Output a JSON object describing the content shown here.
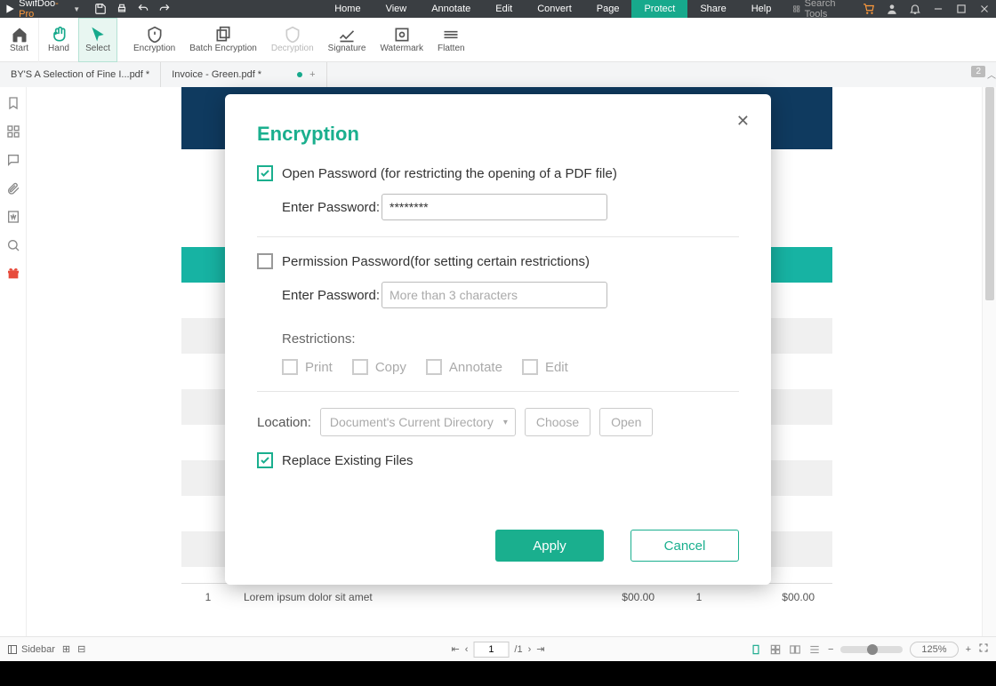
{
  "app": {
    "name1": "SwifDoo",
    "name2": "-Pro"
  },
  "menus": [
    "Home",
    "View",
    "Annotate",
    "Edit",
    "Convert",
    "Page",
    "Protect",
    "Share",
    "Help"
  ],
  "menus_active": 6,
  "search_placeholder": "Search Tools",
  "ribbon": [
    {
      "label": "Start"
    },
    {
      "label": "Hand"
    },
    {
      "label": "Select"
    },
    {
      "label": "Encryption"
    },
    {
      "label": "Batch Encryption"
    },
    {
      "label": "Decryption"
    },
    {
      "label": "Signature"
    },
    {
      "label": "Watermark"
    },
    {
      "label": "Flatten"
    }
  ],
  "tabs": [
    {
      "label": "BY'S A Selection of Fine I...pdf *"
    },
    {
      "label": "Invoice - Green.pdf *"
    }
  ],
  "tab_counter": "2",
  "table_row": {
    "num": "1",
    "desc": "Lorem ipsum dolor sit amet",
    "unit": "$00.00",
    "qty": "1",
    "line": "$00.00"
  },
  "status": {
    "sidebar": "Sidebar",
    "page_current": "1",
    "page_total": "/1",
    "zoom": "125%"
  },
  "modal": {
    "title": "Encryption",
    "open_pw_label": "Open Password (for restricting the opening of a PDF file)",
    "enter_pw": "Enter Password:",
    "open_pw_value": "********",
    "perm_pw_label": "Permission Password(for setting certain restrictions)",
    "perm_pw_placeholder": "More than 3 characters",
    "restrictions_label": "Restrictions:",
    "restrictions": [
      "Print",
      "Copy",
      "Annotate",
      "Edit"
    ],
    "location_label": "Location:",
    "location_value": "Document's Current Directory",
    "choose": "Choose",
    "open": "Open",
    "replace_label": "Replace Existing Files",
    "apply": "Apply",
    "cancel": "Cancel"
  }
}
